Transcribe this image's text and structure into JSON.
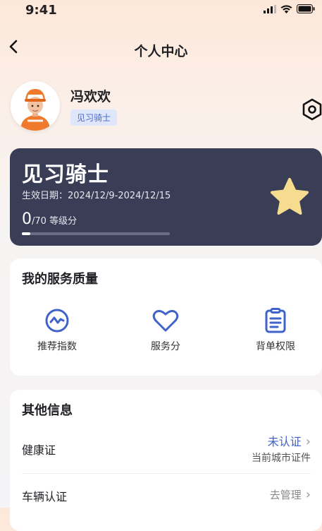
{
  "status_bar": {
    "time": "9:41"
  },
  "nav": {
    "title": "个人中心"
  },
  "profile": {
    "name": "冯欢欢",
    "badge": "见习骑士"
  },
  "level_card": {
    "title": "见习骑士",
    "date_range": "生效日期：2024/12/9-2024/12/15",
    "score": "0",
    "score_total": "/70",
    "score_label": "等级分",
    "progress_fraction": 0
  },
  "service": {
    "title": "我的服务质量",
    "items": [
      {
        "label": "推荐指数",
        "icon": "trend-circle-icon"
      },
      {
        "label": "服务分",
        "icon": "heart-icon"
      },
      {
        "label": "背单权限",
        "icon": "clipboard-icon"
      }
    ]
  },
  "other": {
    "title": "其他信息",
    "rows": [
      {
        "label": "健康证",
        "status": "未认证",
        "sub": "当前城市证件"
      },
      {
        "label": "车辆认证",
        "status": "去管理"
      }
    ]
  },
  "colors": {
    "accent": "#3f63c8",
    "card_dark": "#3a3d56",
    "star": "#f6dc8f"
  }
}
